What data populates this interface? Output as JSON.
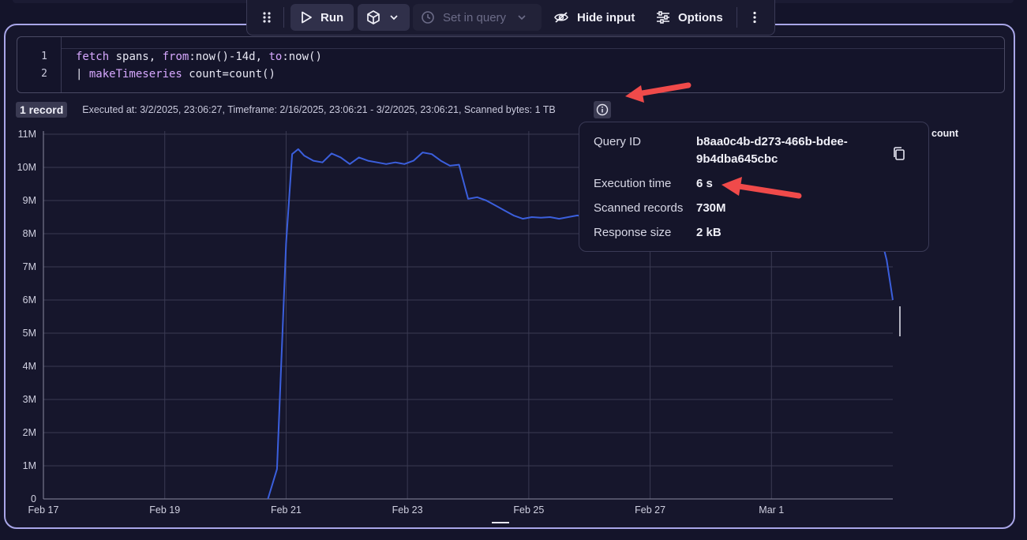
{
  "toolbar": {
    "drag_icon": "drag-handle-icon",
    "run_label": "Run",
    "set_in_query_label": "Set in query",
    "hide_input_label": "Hide input",
    "options_label": "Options"
  },
  "editor": {
    "line_numbers": [
      "1",
      "2"
    ],
    "line1": {
      "kw1": "fetch",
      "t1": " spans, ",
      "kw2": "from",
      "t2": ":now()-14d, ",
      "kw3": "to",
      "t3": ":now()"
    },
    "line2": {
      "t1": "| ",
      "kw1": "makeTimeseries",
      "t2": " count=count()"
    }
  },
  "result": {
    "records_badge": "1 record",
    "meta_text": "Executed at: 3/2/2025, 23:06:27, Timeframe: 2/16/2025, 23:06:21 - 3/2/2025, 23:06:21, Scanned bytes: 1 TB"
  },
  "popover": {
    "query_id_label": "Query ID",
    "query_id_line1": "b8aa0c4b-d273-466b-bdee-",
    "query_id_line2": "9b4dba645cbc",
    "exec_time_label": "Execution time",
    "exec_time_value": "6 s",
    "scanned_records_label": "Scanned records",
    "scanned_records_value": "730M",
    "response_size_label": "Response size",
    "response_size_value": "2 kB"
  },
  "colors": {
    "line": "#3b5fdd",
    "accent_border": "#a9a6e8",
    "arrow": "#f04a4a"
  },
  "chart_data": {
    "type": "line",
    "x_tick_labels": [
      "Feb 17",
      "Feb 19",
      "Feb 21",
      "Feb 23",
      "Feb 25",
      "Feb 27",
      "Mar 1"
    ],
    "y_tick_labels": [
      "0",
      "1M",
      "2M",
      "3M",
      "4M",
      "5M",
      "6M",
      "7M",
      "8M",
      "9M",
      "10M",
      "11M"
    ],
    "ylim": [
      0,
      11000000
    ],
    "xlim_days_from_feb17": [
      0,
      14
    ],
    "grid": true,
    "legend_position": "top-right",
    "series": [
      {
        "name": "count",
        "x_days_from_feb17": [
          3.7,
          3.85,
          4.0,
          4.1,
          4.2,
          4.3,
          4.45,
          4.6,
          4.75,
          4.9,
          5.05,
          5.2,
          5.35,
          5.5,
          5.65,
          5.8,
          5.95,
          6.1,
          6.25,
          6.4,
          6.55,
          6.7,
          6.85,
          7.0,
          7.15,
          7.3,
          7.45,
          7.6,
          7.75,
          7.9,
          8.05,
          8.2,
          8.35,
          8.5,
          8.65,
          8.8,
          8.95,
          9.1,
          9.25,
          9.4,
          9.55,
          9.7,
          9.85,
          10.0,
          10.15,
          10.3,
          10.45,
          10.6,
          10.75,
          10.9,
          11.05,
          11.2,
          11.35,
          11.5,
          11.65,
          11.8,
          11.95,
          12.1,
          12.25,
          12.4,
          12.55,
          12.7,
          12.85,
          13.0,
          13.15,
          13.3,
          13.45,
          13.6,
          13.75,
          13.9,
          14.0
        ],
        "values": [
          0,
          900000,
          7700000,
          10400000,
          10550000,
          10350000,
          10200000,
          10150000,
          10420000,
          10300000,
          10100000,
          10300000,
          10200000,
          10150000,
          10100000,
          10150000,
          10100000,
          10200000,
          10450000,
          10400000,
          10200000,
          10050000,
          10080000,
          9050000,
          9100000,
          9000000,
          8850000,
          8700000,
          8550000,
          8450000,
          8500000,
          8480000,
          8500000,
          8450000,
          8500000,
          8550000,
          8500000,
          8500000,
          8500000,
          8500000,
          8500000,
          8500000,
          8500000,
          8500000,
          8500000,
          8500000,
          8500000,
          8500000,
          8500000,
          8500000,
          8500000,
          8500000,
          8500000,
          8500000,
          8500000,
          8500000,
          8500000,
          8500000,
          8500000,
          8500000,
          8500000,
          8500000,
          8500000,
          8500000,
          8500000,
          8500000,
          8500000,
          8450000,
          8300000,
          7200000,
          6000000
        ]
      }
    ]
  }
}
